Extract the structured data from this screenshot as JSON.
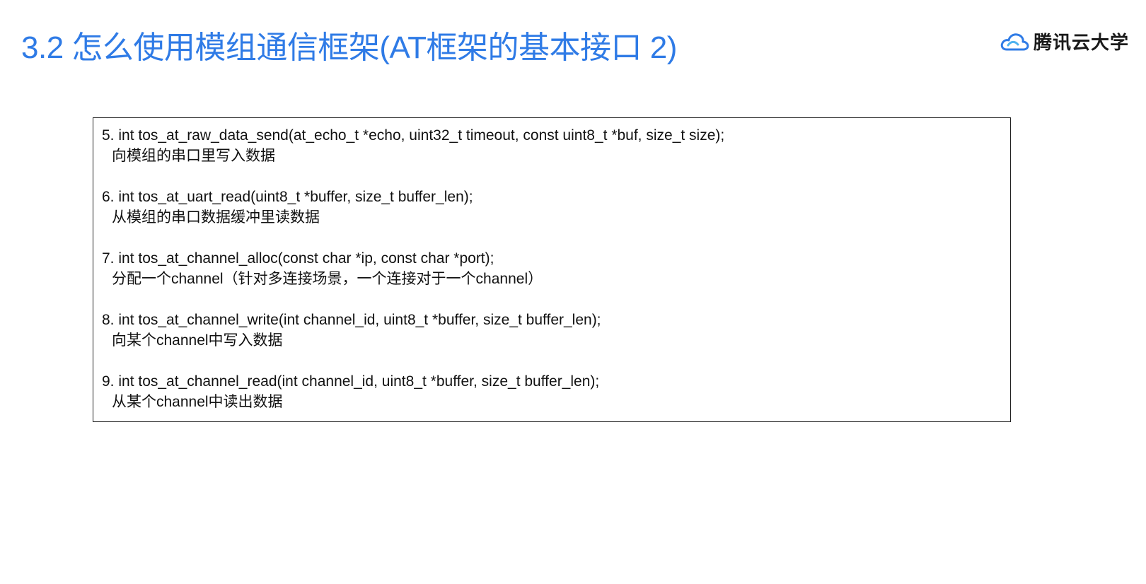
{
  "title": "3.2  怎么使用模组通信框架(AT框架的基本接口 2)",
  "brand": {
    "logo_icon": "cloud-logo-icon",
    "name": "腾讯云大学",
    "colors": {
      "cloud_blue": "#2f7be6",
      "cloud_light": "#4fb3f0"
    }
  },
  "accent_color": "#2f7be6",
  "entries": [
    {
      "signature": "5. int tos_at_raw_data_send(at_echo_t *echo, uint32_t timeout, const uint8_t *buf, size_t size);",
      "description": "向模组的串口里写入数据"
    },
    {
      "signature": "6. int tos_at_uart_read(uint8_t *buffer, size_t buffer_len);",
      "description": "从模组的串口数据缓冲里读数据"
    },
    {
      "signature": "7. int tos_at_channel_alloc(const char *ip, const char *port);",
      "description": "分配一个channel（针对多连接场景，一个连接对于一个channel）"
    },
    {
      "signature": "8. int tos_at_channel_write(int channel_id, uint8_t *buffer, size_t buffer_len);",
      "description": "向某个channel中写入数据"
    },
    {
      "signature": "9. int tos_at_channel_read(int channel_id, uint8_t *buffer, size_t buffer_len);",
      "description": "从某个channel中读出数据"
    }
  ]
}
